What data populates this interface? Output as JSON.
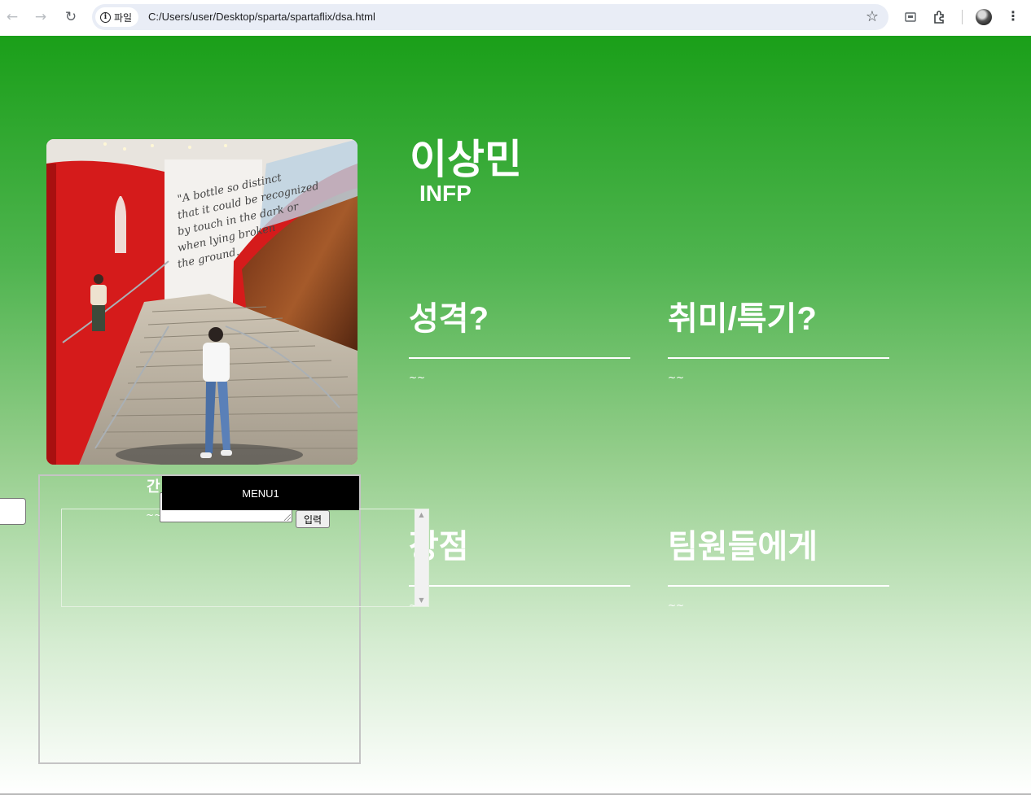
{
  "browser": {
    "back_icon": "arrow-left-icon",
    "forward_icon": "arrow-right-icon",
    "reload_icon": "reload-icon",
    "site_chip_label": "파일",
    "url": "C:/Users/user/Desktop/sparta/spartaflix/dsa.html"
  },
  "profile": {
    "name": "이상민",
    "mbti": "INFP"
  },
  "sections": [
    {
      "title": "성격?",
      "content": "~~"
    },
    {
      "title": "취미/특기?",
      "content": "~~"
    },
    {
      "title": "장점",
      "content": "~~"
    },
    {
      "title": "팀원들에게",
      "content": "~~"
    }
  ],
  "guestbook": {
    "title": "간",
    "entry": "~~",
    "submit_label": "입력"
  },
  "menu": {
    "label": "MENU1"
  },
  "photo": {
    "quote": "\"A bottle so distinct that it could be recognized by touch in the dark or when lying broken on the ground.\""
  },
  "colors": {
    "gradient_top": "#1a9f19",
    "gradient_bottom": "#ffffff",
    "menu_bg": "#000000"
  }
}
